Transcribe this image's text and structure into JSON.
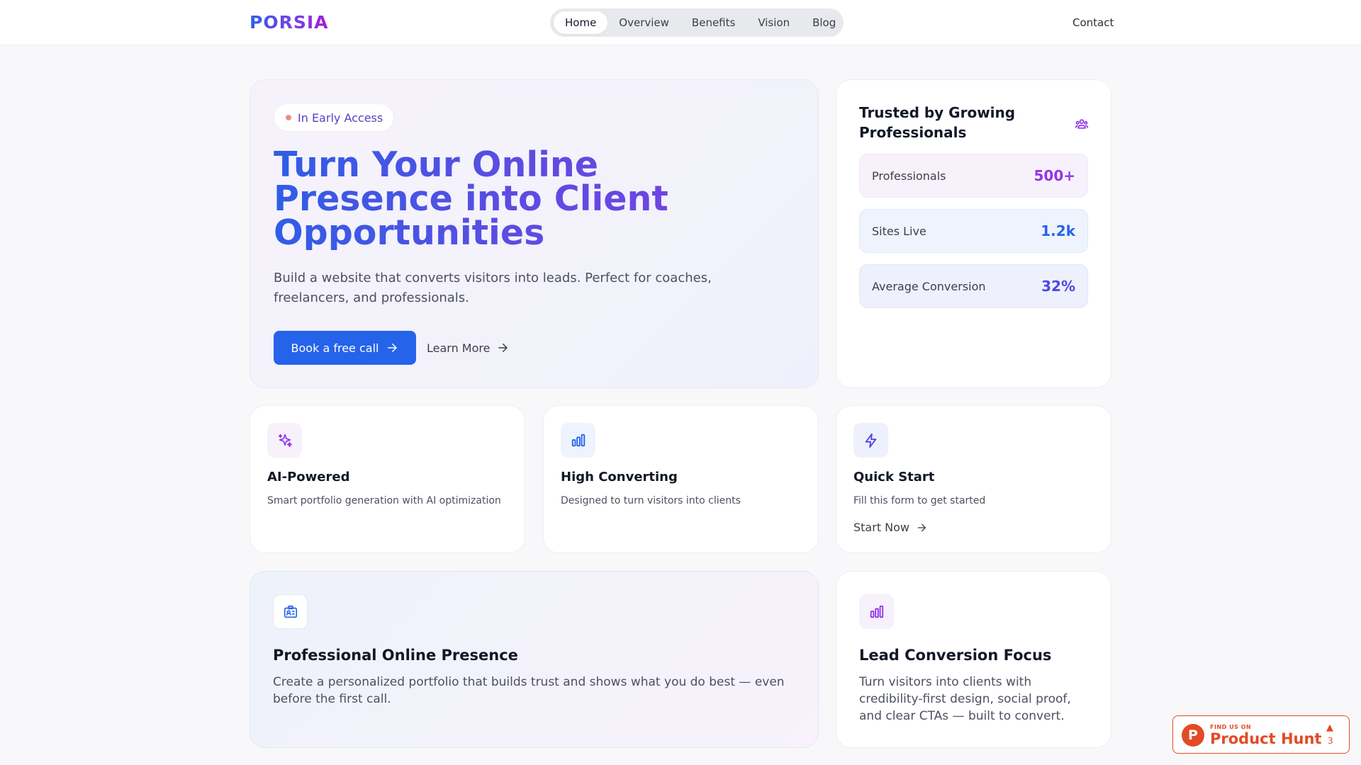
{
  "brand": {
    "logo": "PORSIA"
  },
  "nav": {
    "items": [
      {
        "label": "Home",
        "active": true
      },
      {
        "label": "Overview"
      },
      {
        "label": "Benefits"
      },
      {
        "label": "Vision"
      },
      {
        "label": "Blog"
      }
    ],
    "contact": "Contact"
  },
  "hero": {
    "badge": "In Early Access",
    "title": "Turn Your Online Presence into Client Opportunities",
    "subtitle": "Build a website that converts visitors into leads. Perfect for coaches, freelancers, and professionals.",
    "primary_cta": "Book a free call",
    "secondary_cta": "Learn More"
  },
  "trusted": {
    "title": "Trusted by Growing Professionals",
    "icon": "users-icon",
    "stats": [
      {
        "label": "Professionals",
        "value": "500+",
        "color": "#9333ea",
        "bg": "#f7f1fb"
      },
      {
        "label": "Sites Live",
        "value": "1.2k",
        "color": "#2563eb",
        "bg": "#eef3fd"
      },
      {
        "label": "Average Conversion",
        "value": "32%",
        "color": "#4f46e5",
        "bg": "#eef0fc"
      }
    ]
  },
  "features": [
    {
      "icon": "sparkles-icon",
      "title": "AI-Powered",
      "desc": "Smart portfolio generation with AI optimization",
      "accent": "#9333ea"
    },
    {
      "icon": "bar-chart-icon",
      "title": "High Converting",
      "desc": "Designed to turn visitors into clients",
      "accent": "#2563eb"
    },
    {
      "icon": "lightning-icon",
      "title": "Quick Start",
      "desc": "Fill this form to get started",
      "link": "Start Now",
      "accent": "#4f46e5"
    }
  ],
  "bottom": {
    "presence": {
      "icon": "id-card-icon",
      "title": "Professional Online Presence",
      "desc": "Create a personalized portfolio that builds trust and shows what you do best — even before the first call."
    },
    "conversion": {
      "icon": "bar-chart-icon",
      "title": "Lead Conversion Focus",
      "desc": "Turn visitors into clients with credibility-first design, social proof, and clear CTAs — built to convert."
    }
  },
  "product_hunt": {
    "small": "FIND US ON",
    "big": "Product Hunt",
    "count": "3",
    "color": "#e24b26"
  }
}
